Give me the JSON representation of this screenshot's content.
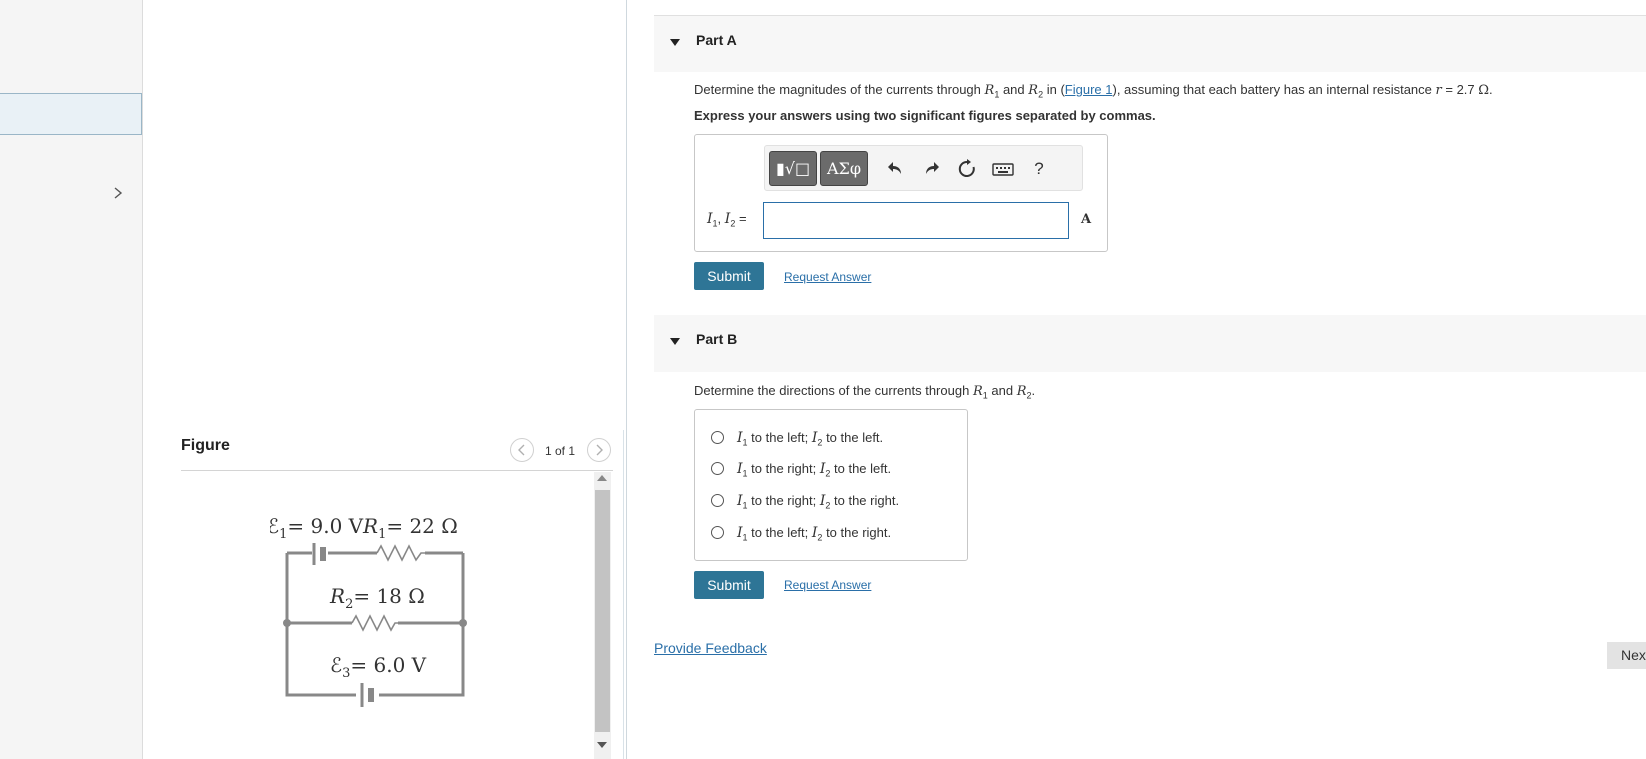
{
  "sidebar": {
    "chevron_icon": "chevron-right-icon"
  },
  "figure": {
    "title": "Figure",
    "counter": "1 of 1",
    "prev_icon": "chevron-left-icon",
    "next_icon": "chevron-right-icon",
    "labels": {
      "emf1_symbol": "ℰ",
      "emf1_sub": "1",
      "emf1_value": "= 9.0 V",
      "r1_symbol": "R",
      "r1_sub": "1",
      "r1_value": "= 22 Ω",
      "r2_symbol": "R",
      "r2_sub": "2",
      "r2_value": "= 18 Ω",
      "emf3_symbol": "ℰ",
      "emf3_sub": "3",
      "emf3_value": "= 6.0 V"
    }
  },
  "part_a": {
    "label": "Part A",
    "question_pre": "Determine the magnitudes of the currents through",
    "r1": "R",
    "r1_sub": "1",
    "and": "and",
    "r2": "R",
    "r2_sub": "2",
    "in": "in (",
    "figure_link": "Figure 1",
    "question_post": "), assuming that each battery has an internal resistance",
    "r_sym": "r",
    "r_value": "= 2.7",
    "r_unit": "Ω",
    "period": ".",
    "instructions": "Express your answers using two significant figures separated by commas.",
    "toolbar": {
      "templates": "▮√□",
      "symbols": "ΑΣφ",
      "undo_icon": "undo-icon",
      "redo_icon": "redo-icon",
      "reset_icon": "reset-icon",
      "keyboard_icon": "keyboard-icon",
      "help": "?"
    },
    "answer_i1": "I",
    "answer_i1_sub": "1",
    "answer_sep": ",",
    "answer_i2": "I",
    "answer_i2_sub": "2",
    "answer_eq": "=",
    "answer_value": "",
    "unit": "A",
    "submit": "Submit",
    "request": "Request Answer"
  },
  "part_b": {
    "label": "Part B",
    "question_pre": "Determine the directions of the currents through",
    "r1": "R",
    "r1_sub": "1",
    "and": "and",
    "r2": "R",
    "r2_sub": "2",
    "period": ".",
    "choices": [
      {
        "i1_text": "to the left;",
        "i2_text": "to the left."
      },
      {
        "i1_text": "to the right;",
        "i2_text": "to the left."
      },
      {
        "i1_text": "to the right;",
        "i2_text": "to the right."
      },
      {
        "i1_text": "to the left;",
        "i2_text": "to the right."
      }
    ],
    "submit": "Submit",
    "request": "Request Answer"
  },
  "footer": {
    "feedback": "Provide Feedback",
    "next": "Nex"
  }
}
